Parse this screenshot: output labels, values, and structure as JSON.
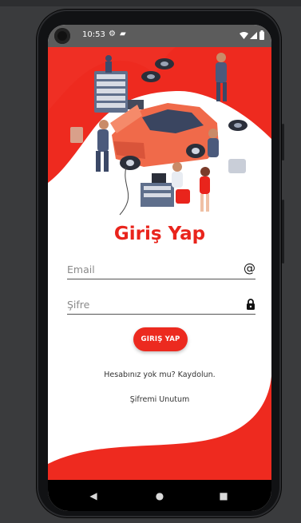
{
  "status_bar": {
    "time": "10:53",
    "left_icons": [
      "settings-icon",
      "lock-icon"
    ],
    "right_icons": [
      "wifi-icon",
      "signal-icon",
      "battery-icon"
    ]
  },
  "colors": {
    "accent": "#e9241c",
    "button": "#ec2a1f",
    "status_bar_bg": "#5c5c5c",
    "nav_bar_bg": "#000000"
  },
  "login": {
    "title": "Giriş Yap",
    "email_placeholder": "Email",
    "password_placeholder": "Şifre",
    "email_icon": "@",
    "password_icon": "🔒",
    "button_label": "GIRIŞ YAP",
    "register_link": "Hesabınız yok mu? Kaydolun.",
    "forgot_link": "Şifremi Unutum"
  },
  "nav": {
    "back": "◀",
    "home": "●",
    "recents": "■"
  }
}
